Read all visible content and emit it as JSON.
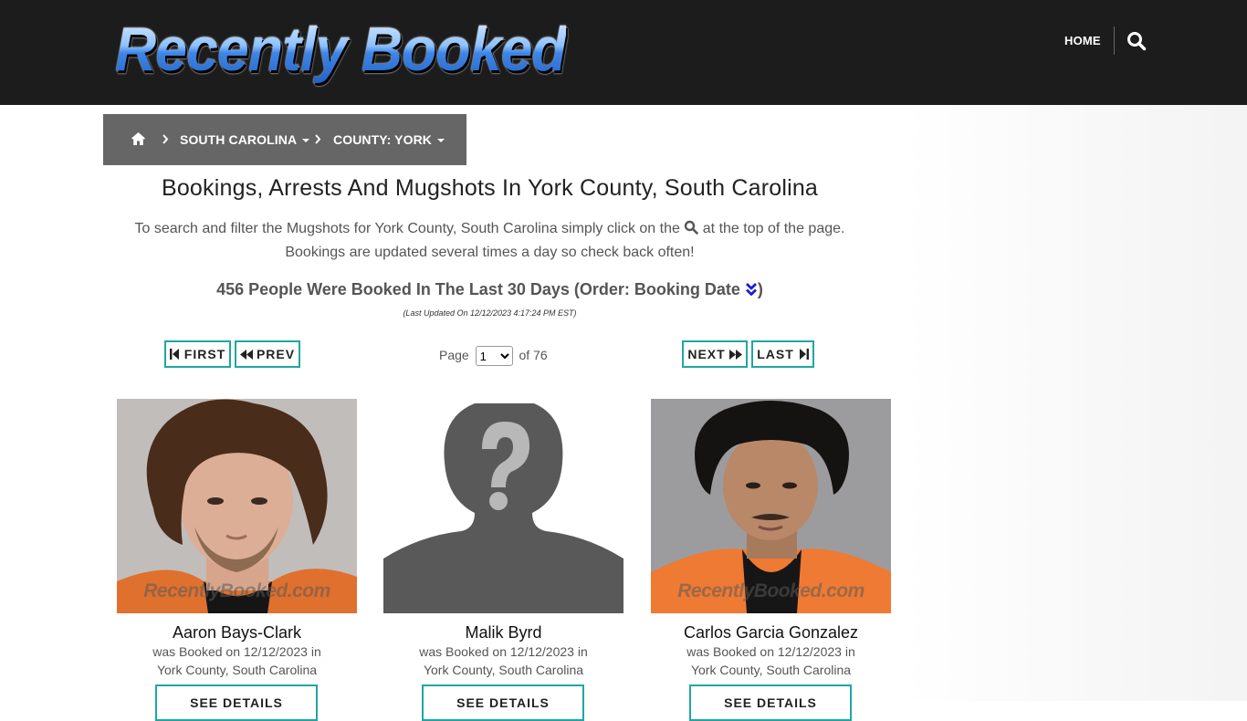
{
  "header": {
    "logo_text": "Recently Booked",
    "nav_home": "HOME",
    "search_icon": "search-icon"
  },
  "breadcrumb": {
    "home_icon": "home-icon",
    "state": "SOUTH CAROLINA",
    "county": "COUNTY: YORK"
  },
  "page": {
    "title": "Bookings, Arrests And Mugshots In York County, South Carolina",
    "intro_before": "To search and filter the Mugshots for York County, South Carolina simply click on the",
    "intro_after": "at the top of the page.",
    "intro_line2": "Bookings are updated several times a day so check back often!",
    "count_text": "456 People Were Booked In The Last 30 Days (Order: Booking Date",
    "count_close": ")",
    "updated": "(Last Updated On 12/12/2023 4:17:24 PM EST)"
  },
  "pager": {
    "first": "FIRST",
    "prev": "PREV",
    "page_label": "Page",
    "current_page": "1",
    "of_label": "of 76",
    "next": "NEXT",
    "last": "LAST"
  },
  "cards": [
    {
      "name": "Aaron Bays-Clark",
      "line1": "was Booked on 12/12/2023 in",
      "line2": "York County, South Carolina",
      "button": "SEE DETAILS",
      "watermark": "RecentlyBooked.com",
      "photo": "mugshot"
    },
    {
      "name": "Malik Byrd",
      "line1": "was Booked on 12/12/2023 in",
      "line2": "York County, South Carolina",
      "button": "SEE DETAILS",
      "photo": "placeholder-silhouette"
    },
    {
      "name": "Carlos Garcia Gonzalez",
      "line1": "was Booked on 12/12/2023 in",
      "line2": "York County, South Carolina",
      "button": "SEE DETAILS",
      "watermark": "RecentlyBooked.com",
      "photo": "mugshot"
    }
  ],
  "colors": {
    "topbar": "#1c1c1c",
    "breadcrumb": "#666666",
    "accent": "#1fa7a2",
    "order_icon": "#1a1adb"
  }
}
